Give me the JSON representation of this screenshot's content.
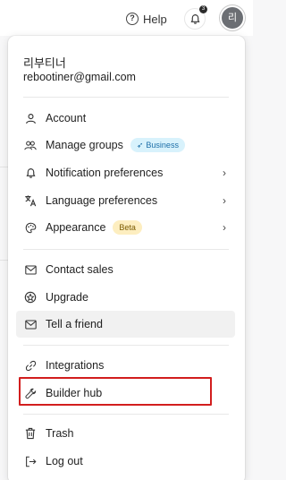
{
  "topbar": {
    "help_label": "Help",
    "notification_count": "3",
    "avatar_initial": "리"
  },
  "user": {
    "name": "리부티너",
    "email": "rebootiner@gmail.com"
  },
  "menu": {
    "account": "Account",
    "manage_groups": "Manage groups",
    "business_badge": "Business",
    "notification_preferences": "Notification preferences",
    "language_preferences": "Language preferences",
    "appearance": "Appearance",
    "beta_badge": "Beta",
    "contact_sales": "Contact sales",
    "upgrade": "Upgrade",
    "tell_a_friend": "Tell a friend",
    "integrations": "Integrations",
    "builder_hub": "Builder hub",
    "trash": "Trash",
    "log_out": "Log out"
  },
  "icons": {
    "account": "person-icon",
    "manage_groups": "group-icon",
    "notification_preferences": "bell-icon",
    "language_preferences": "translate-icon",
    "appearance": "palette-icon",
    "contact_sales": "mail-icon",
    "upgrade": "upgrade-icon",
    "tell_a_friend": "mail-icon",
    "integrations": "link-icon",
    "builder_hub": "wrench-icon",
    "trash": "trash-icon",
    "log_out": "logout-icon"
  },
  "colors": {
    "highlight_border": "#d21e1e",
    "business_badge_bg": "#d8f2fc",
    "beta_badge_bg": "#fdeec0",
    "hover_bg": "#f1f1f1"
  }
}
